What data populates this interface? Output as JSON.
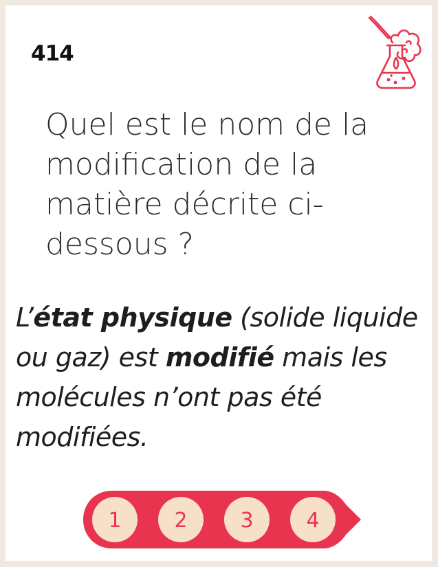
{
  "card": {
    "number": "414",
    "question": "Quel est le nom de la modification de la matière décrite ci-dessous ?",
    "description": {
      "prefix": "L’",
      "bold1": "état physique",
      "mid1": " (solide liquide ou gaz) est ",
      "bold2": "modifié",
      "suffix": " mais les molécules n’ont pas été modifiées."
    },
    "steps": [
      "1",
      "2",
      "3",
      "4"
    ]
  },
  "colors": {
    "accent": "#e8344e",
    "step_fill": "#f7e0c8",
    "background": "#efe9e2",
    "card": "#ffffff"
  },
  "icons": {
    "header": "chemistry-flask-icon"
  }
}
